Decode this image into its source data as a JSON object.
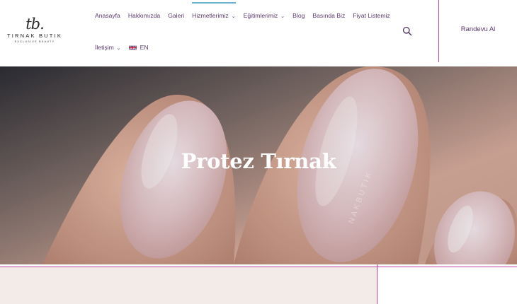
{
  "brand": {
    "monogram": "tb.",
    "name": "TIRNAK BUTIK",
    "tagline": "EXCLUSIVE BEAUTY"
  },
  "nav": {
    "row1": [
      {
        "label": "Anasayfa",
        "dropdown": false
      },
      {
        "label": "Hakkımızda",
        "dropdown": false
      },
      {
        "label": "Galeri",
        "dropdown": false
      },
      {
        "label": "Hizmetlerimiz",
        "dropdown": true
      },
      {
        "label": "Eğitimlerimiz",
        "dropdown": true
      },
      {
        "label": "Blog",
        "dropdown": false
      },
      {
        "label": "Basında Biz",
        "dropdown": false
      },
      {
        "label": "Fiyat Listemiz",
        "dropdown": false
      }
    ],
    "row2": [
      {
        "label": "İletişim",
        "dropdown": true
      }
    ],
    "language": "EN",
    "active_item": "Hizmetlerimiz"
  },
  "header": {
    "search_icon": "search-icon",
    "cta_label": "Randevu Al"
  },
  "hero": {
    "title": "Protez Tırnak",
    "watermark": "NAKBUTIK"
  },
  "colors": {
    "accent_line": "#c23ea0",
    "nav_text": "#5a3a6e",
    "active_indicator": "#6ab3cf",
    "bottom_bg": "#f2ebe7"
  }
}
